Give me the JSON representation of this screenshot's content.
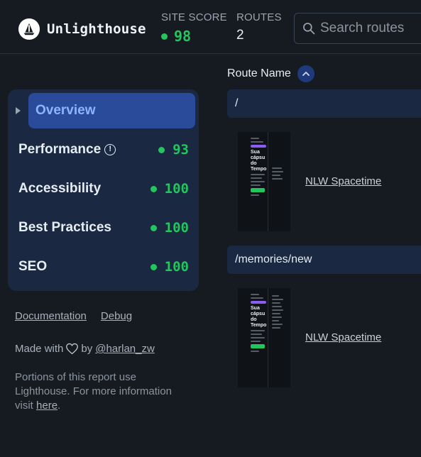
{
  "header": {
    "app_name": "Unlighthouse",
    "site_score_label": "SITE SCORE",
    "site_score_value": "98",
    "routes_label": "ROUTES",
    "routes_value": "2",
    "search_placeholder": "Search routes"
  },
  "sidebar": {
    "items": [
      {
        "label": "Overview",
        "score": "",
        "active": true
      },
      {
        "label": "Performance",
        "score": "93",
        "icon": "info-icon"
      },
      {
        "label": "Accessibility",
        "score": "100"
      },
      {
        "label": "Best Practices",
        "score": "100"
      },
      {
        "label": "SEO",
        "score": "100"
      }
    ]
  },
  "footer": {
    "documentation": "Documentation",
    "debug": "Debug",
    "made_with": "Made with",
    "by": "by",
    "author": "@harlan_zw",
    "portions_text": "Portions of this report use Lighthouse. For more information visit",
    "here": "here",
    "period": "."
  },
  "table": {
    "column_header": "Route Name",
    "routes": [
      {
        "path": "/",
        "title": "NLW Spacetime"
      },
      {
        "path": "/memories/new",
        "title": "NLW Spacetime"
      }
    ]
  },
  "colors": {
    "background": "#161b22",
    "card": "#1a2841",
    "active": "#2a4a9a",
    "score_good": "#22c55e"
  }
}
